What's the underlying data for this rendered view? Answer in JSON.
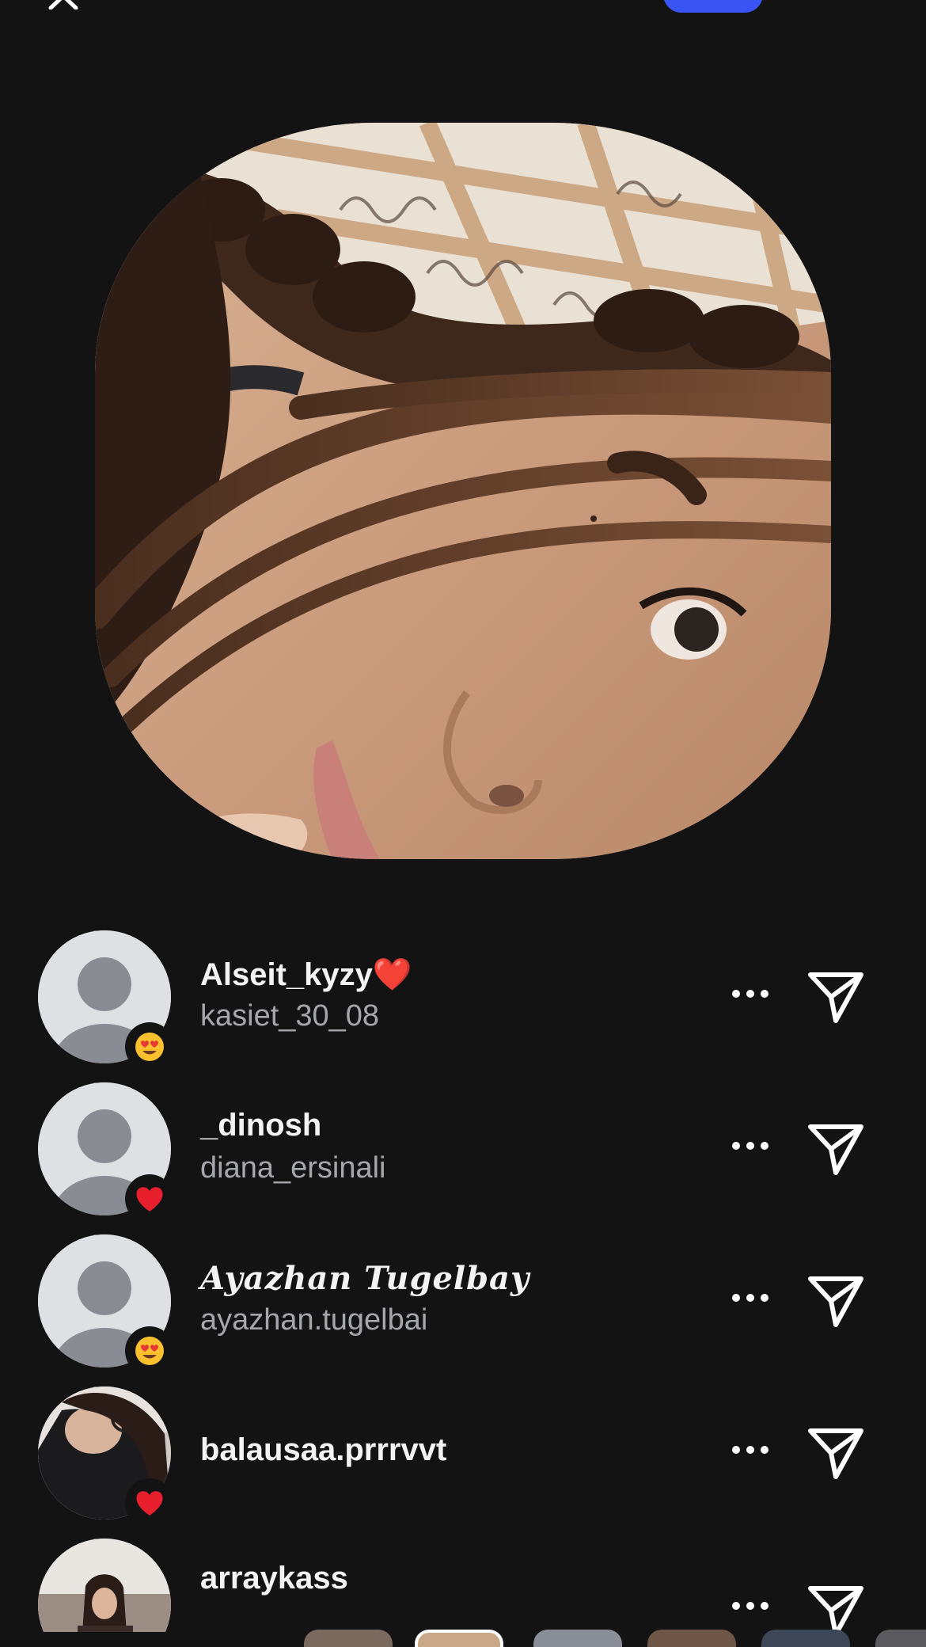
{
  "topbar": {
    "close_icon": "close-icon",
    "accent_button_color": "#3a54f3"
  },
  "story": {
    "image": "story-selfie-photo"
  },
  "viewers": [
    {
      "display_name": "Alseit_kyzy❤️",
      "username": "kasiet_30_08",
      "reaction": "heart-eyes-emoji",
      "avatar": "default-avatar"
    },
    {
      "display_name": "_dinosh",
      "username": "diana_ersinali",
      "reaction": "red-heart-emoji",
      "avatar": "default-avatar"
    },
    {
      "display_name": "Ayazhan Tugelbay",
      "username": "ayazhan.tugelbai",
      "reaction": "heart-eyes-emoji",
      "avatar": "default-avatar"
    },
    {
      "display_name": "balausaa.prrrvvt",
      "username": "",
      "reaction": "red-heart-emoji",
      "avatar": "photo-avatar"
    },
    {
      "display_name": "arraykass",
      "username": "",
      "reaction": "",
      "avatar": "photo-avatar"
    }
  ],
  "icons": {
    "more": "more-options-icon",
    "send": "send-paper-plane-icon"
  },
  "colors": {
    "background": "#131314",
    "secondary_text": "#a6a7ab",
    "accent": "#3a54f3"
  }
}
